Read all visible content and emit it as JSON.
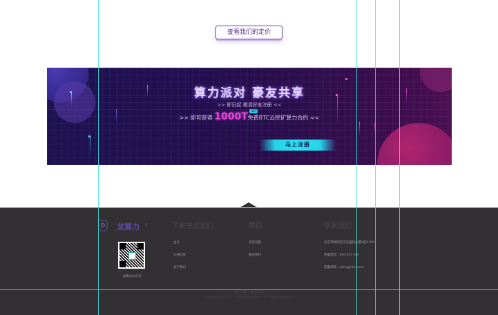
{
  "pricing": {
    "button_label": "查看我们的定价"
  },
  "banner": {
    "title": "算力派对 豪友共享",
    "subtitle": ">> 即日起 邀请好友注册 <<",
    "offer_prefix": ">> 即可获得",
    "offer_amount": "1000T",
    "offer_badge": "HOT",
    "offer_suffix": "免费BTC云挖矿算力合约 <<",
    "register_label": "马上注册",
    "accent_colors": {
      "magenta": "#e347d6",
      "cyan": "#28e2f2",
      "bg": "#220f4e"
    }
  },
  "footer": {
    "logo": {
      "mark": "D",
      "name": "龙算力",
      "registered": "®"
    },
    "qr_caption": "龙算力公众号",
    "columns": {
      "follow": {
        "title": "了解关注我们",
        "links": [
          "主页",
          "价格信息",
          "关于我们"
        ]
      },
      "help": {
        "title": "帮助",
        "links": [
          "常见问题",
          "服务条约"
        ]
      },
      "contact": {
        "title": "联系我们",
        "address": "北京市朝阳区平安国际大厦A座2409",
        "phone": "客服电话：400-201-302",
        "email": "客服邮箱：john@john.com"
      }
    },
    "bottom_links": "隐私政策 | 服务条款",
    "copyright": "Copyright © 2017 – 2018 Jusanswhe. All Rights Reserved",
    "bg_color": "#333034"
  }
}
